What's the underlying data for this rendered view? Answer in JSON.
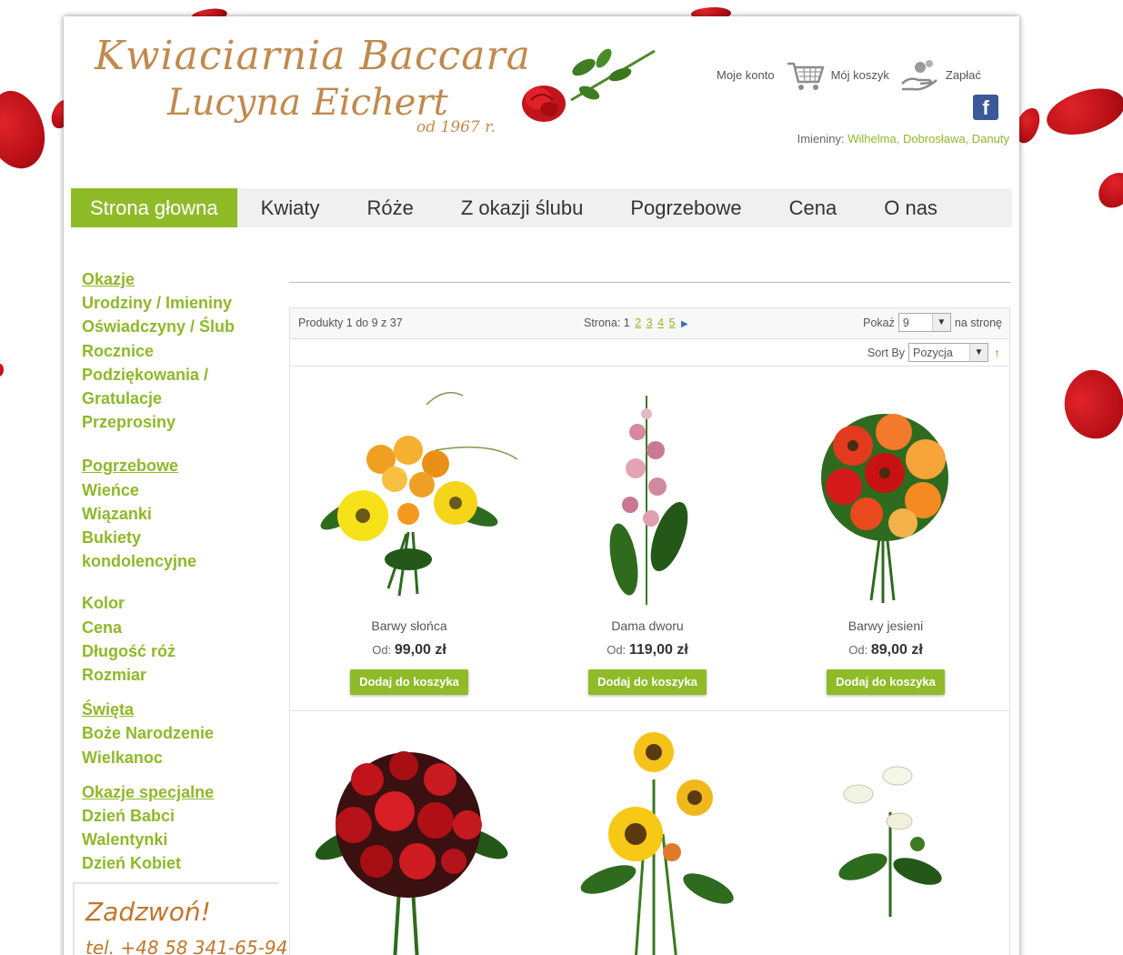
{
  "header": {
    "logo_line1": "Kwiaciarnia Baccara",
    "logo_line2": "Lucyna Eichert",
    "logo_since": "od 1967 r.",
    "account_link": "Moje konto",
    "cart_link": "Mój koszyk",
    "pay_link": "Zapłać",
    "namedays_label": "Imieniny:",
    "namedays_names": "Wilhelma, Dobrosława, Danuty"
  },
  "nav": [
    {
      "label": "Strona głowna",
      "active": true
    },
    {
      "label": "Kwiaty"
    },
    {
      "label": "Róże"
    },
    {
      "label": "Z okazji ślubu"
    },
    {
      "label": "Pogrzebowe"
    },
    {
      "label": "Cena"
    },
    {
      "label": "O nas"
    }
  ],
  "sidebar": {
    "groups": [
      {
        "head": "Okazje",
        "links": [
          "Urodziny / Imieniny",
          "Oświadczyny / Ślub",
          "Rocznice",
          "Podziękowania /",
          "Gratulacje",
          "Przeprosiny"
        ]
      },
      {
        "head": "Pogrzebowe",
        "links": [
          "Wieńce",
          "Wiązanki",
          "Bukiety",
          "kondolencyjne"
        ]
      },
      {
        "head": "",
        "links": [
          "Kolor",
          "Cena",
          "Długość róż",
          "Rozmiar"
        ]
      },
      {
        "head": "Święta",
        "links": [
          "Boże Narodzenie",
          "Wielkanoc"
        ]
      },
      {
        "head": "Okazje specjalne",
        "links": [
          "Dzień Babci",
          "Walentynki",
          "Dzień Kobiet"
        ]
      }
    ],
    "call_title": "Zadzwoń!",
    "call_tel": "tel. +48 58 341-65-94"
  },
  "toolbar": {
    "count": "Produkty 1 do 9 z 37",
    "pages_label": "Strona:",
    "current_page": "1",
    "pages": [
      "2",
      "3",
      "4",
      "5"
    ],
    "show_label": "Pokaż",
    "show_value": "9",
    "per_page_label": "na stronę",
    "sort_label": "Sort By",
    "sort_value": "Pozycja"
  },
  "products": [
    {
      "name": "Barwy słońca",
      "price_prefix": "Od:",
      "price": "99,00 zł",
      "button": "Dodaj do koszyka"
    },
    {
      "name": "Dama dworu",
      "price_prefix": "Od:",
      "price": "119,00 zł",
      "button": "Dodaj do koszyka"
    },
    {
      "name": "Barwy jesieni",
      "price_prefix": "Od:",
      "price": "89,00 zł",
      "button": "Dodaj do koszyka"
    }
  ],
  "colors": {
    "accent_green": "#8fbb29",
    "logo_gold": "#c08a4e",
    "call_orange": "#c0762c"
  }
}
